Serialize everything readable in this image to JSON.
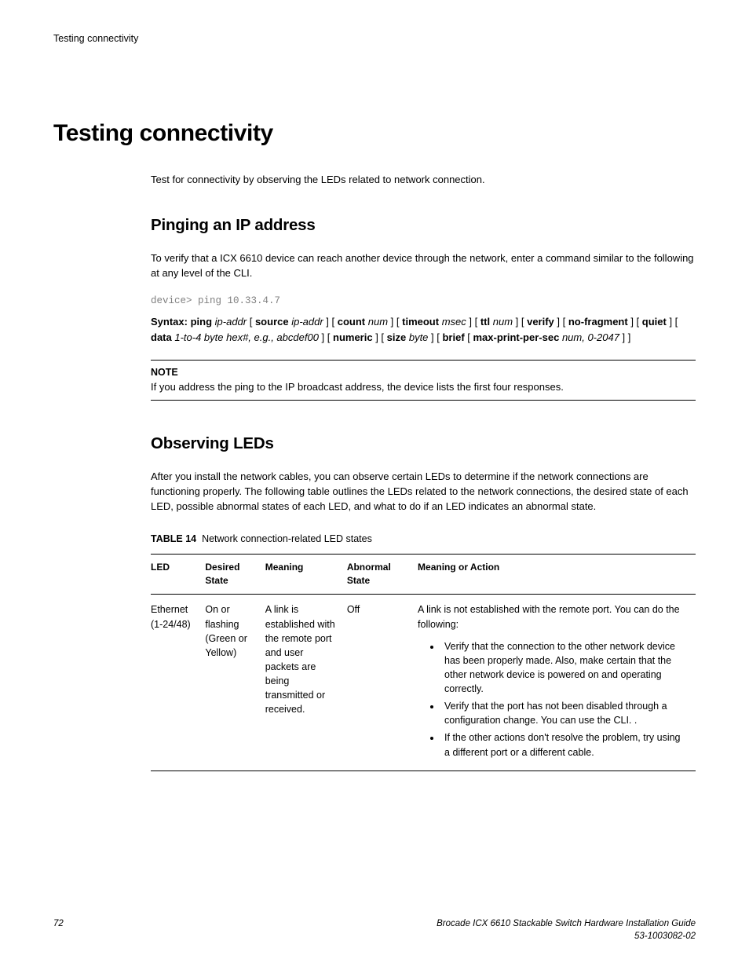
{
  "header": {
    "section_title": "Testing connectivity"
  },
  "main": {
    "heading": "Testing connectivity",
    "intro": "Test for connectivity by observing the LEDs related to network connection."
  },
  "ping": {
    "heading": "Pinging an IP address",
    "intro": "To verify that a ICX 6610 device can reach another device through the network, enter a command similar to the following at any level of the CLI.",
    "code": "device> ping 10.33.4.7",
    "syntax": {
      "s1a": "Syntax: ping",
      "s1b": "ip-addr",
      "s1c": "source",
      "s1d": "ip-addr",
      "s1e": "count",
      "s1f": "num",
      "s1g": "timeout",
      "s1h": "msec",
      "s1i": "ttl",
      "s1j": "num",
      "s1k": "verify",
      "s1l": "no-fragment",
      "s1m": "quiet",
      "s1n": "data",
      "s1o": "1-to-4 byte hex#, e.g., abcdef00",
      "s1p": "numeric",
      "s1q": "size",
      "s1r": "byte",
      "s1s": "brief",
      "s1t": "max-print-per-sec",
      "s1u": "num, 0-2047"
    },
    "note_label": "NOTE",
    "note_body": "If you address the ping to the IP broadcast address, the device lists the first four responses."
  },
  "leds": {
    "heading": "Observing LEDs",
    "intro": "After you install the network cables, you can observe certain LEDs to determine if the network connections are functioning properly. The following table outlines the LEDs related to the network connections, the desired state of each LED, possible abnormal states of each LED, and what to do if an LED indicates an abnormal state.",
    "table_caption_label": "TABLE 14",
    "table_caption_text": "Network connection-related LED states",
    "columns": {
      "led": "LED",
      "desired": "Desired State",
      "meaning": "Meaning",
      "abnormal": "Abnormal State",
      "action": "Meaning or Action"
    },
    "row1": {
      "led": "Ethernet (1-24/48)",
      "desired": "On or flashing (Green or Yellow)",
      "meaning": "A link is established with the remote port and user packets are being transmitted or received.",
      "abnormal": "Off",
      "action_intro": "A link is not established with the remote port. You can do the following:",
      "bullets": {
        "b1": "Verify that the connection to the other network device has been properly made. Also, make certain that the other network device is powered on and operating correctly.",
        "b2": "Verify that the port has not been disabled through a configuration change. You can use the CLI. .",
        "b3": "If the other actions don't resolve the problem, try using a different port or a different cable."
      }
    }
  },
  "footer": {
    "page_number": "72",
    "guide_title": "Brocade ICX 6610 Stackable Switch Hardware Installation Guide",
    "doc_id": "53-1003082-02"
  }
}
